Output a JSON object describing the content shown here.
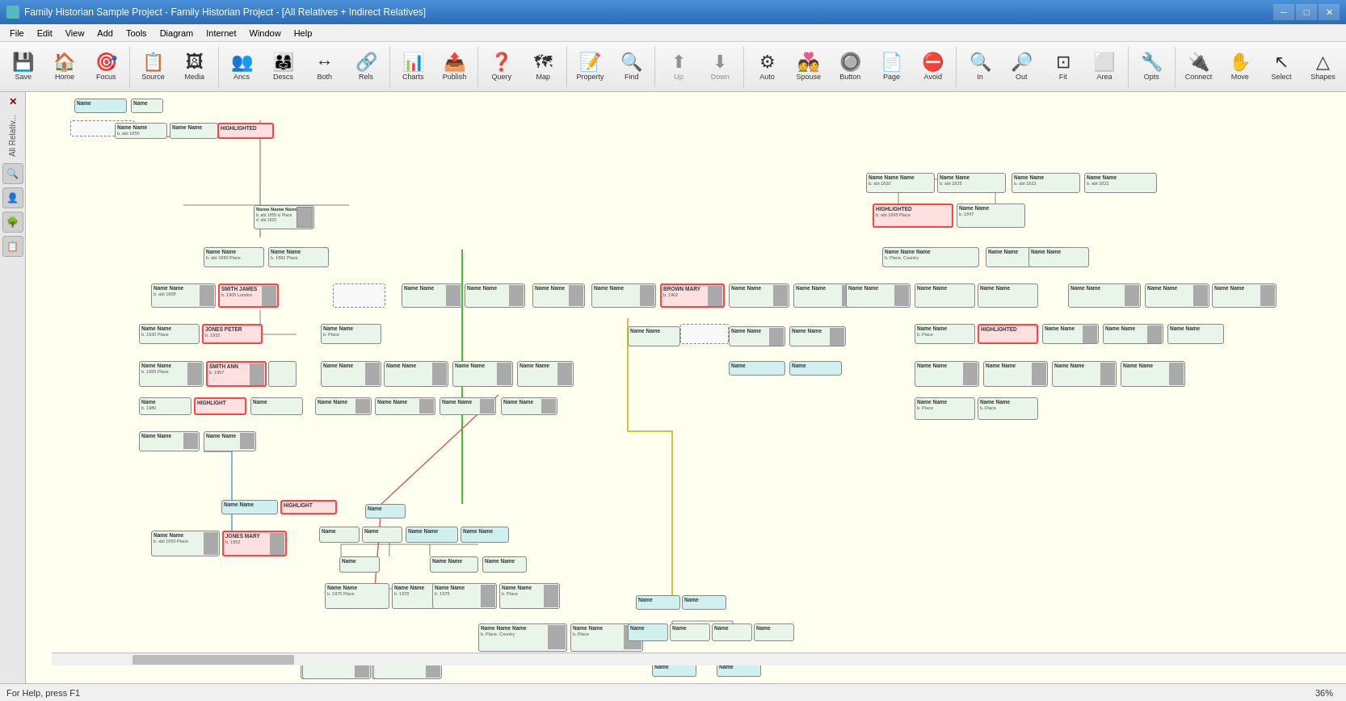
{
  "titlebar": {
    "title": "Family Historian Sample Project - Family Historian Project - [All Relatives + Indirect Relatives]",
    "minimize": "─",
    "maximize": "□",
    "close": "✕"
  },
  "menubar": {
    "items": [
      "File",
      "Edit",
      "View",
      "Add",
      "Tools",
      "Diagram",
      "Internet",
      "Window",
      "Help"
    ]
  },
  "toolbar": {
    "buttons": [
      {
        "id": "save",
        "icon": "💾",
        "label": "Save"
      },
      {
        "id": "home",
        "icon": "🏠",
        "label": "Home"
      },
      {
        "id": "focus",
        "icon": "🎯",
        "label": "Focus"
      },
      {
        "id": "source",
        "icon": "📋",
        "label": "Source"
      },
      {
        "id": "media",
        "icon": "🖼",
        "label": "Media"
      },
      {
        "id": "ancs",
        "icon": "👥",
        "label": "Ancs"
      },
      {
        "id": "descs",
        "icon": "👨‍👩‍👧",
        "label": "Descs"
      },
      {
        "id": "both",
        "icon": "↔",
        "label": "Both"
      },
      {
        "id": "rels",
        "icon": "🔗",
        "label": "Rels"
      },
      {
        "id": "charts",
        "icon": "📊",
        "label": "Charts"
      },
      {
        "id": "publish",
        "icon": "📤",
        "label": "Publish"
      },
      {
        "id": "query",
        "icon": "❓",
        "label": "Query"
      },
      {
        "id": "map",
        "icon": "🗺",
        "label": "Map"
      },
      {
        "id": "property",
        "icon": "📝",
        "label": "Property"
      },
      {
        "id": "find",
        "icon": "🔍",
        "label": "Find"
      },
      {
        "id": "up",
        "icon": "⬆",
        "label": "Up"
      },
      {
        "id": "down",
        "icon": "⬇",
        "label": "Down"
      },
      {
        "id": "auto",
        "icon": "⚙",
        "label": "Auto"
      },
      {
        "id": "spouse",
        "icon": "💑",
        "label": "Spouse"
      },
      {
        "id": "button",
        "icon": "🔘",
        "label": "Button"
      },
      {
        "id": "page",
        "icon": "📄",
        "label": "Page"
      },
      {
        "id": "avoid",
        "icon": "⛔",
        "label": "Avoid"
      },
      {
        "id": "in",
        "icon": "🔍+",
        "label": "In"
      },
      {
        "id": "out",
        "icon": "🔍-",
        "label": "Out"
      },
      {
        "id": "fit",
        "icon": "⊡",
        "label": "Fit"
      },
      {
        "id": "area",
        "icon": "⬜",
        "label": "Area"
      },
      {
        "id": "opts",
        "icon": "🔧",
        "label": "Opts"
      },
      {
        "id": "connect",
        "icon": "🔌",
        "label": "Connect"
      },
      {
        "id": "move",
        "icon": "✋",
        "label": "Move"
      },
      {
        "id": "select",
        "icon": "↖",
        "label": "Select"
      },
      {
        "id": "shapes",
        "icon": "△",
        "label": "Shapes"
      }
    ]
  },
  "sidebar": {
    "label": "All Relativ...",
    "buttons": [
      "🔍",
      "👤",
      "🌳",
      "📋"
    ]
  },
  "statusbar": {
    "help_text": "For Help, press F1",
    "zoom": "36%"
  },
  "canvas": {
    "background": "#fffff0"
  }
}
